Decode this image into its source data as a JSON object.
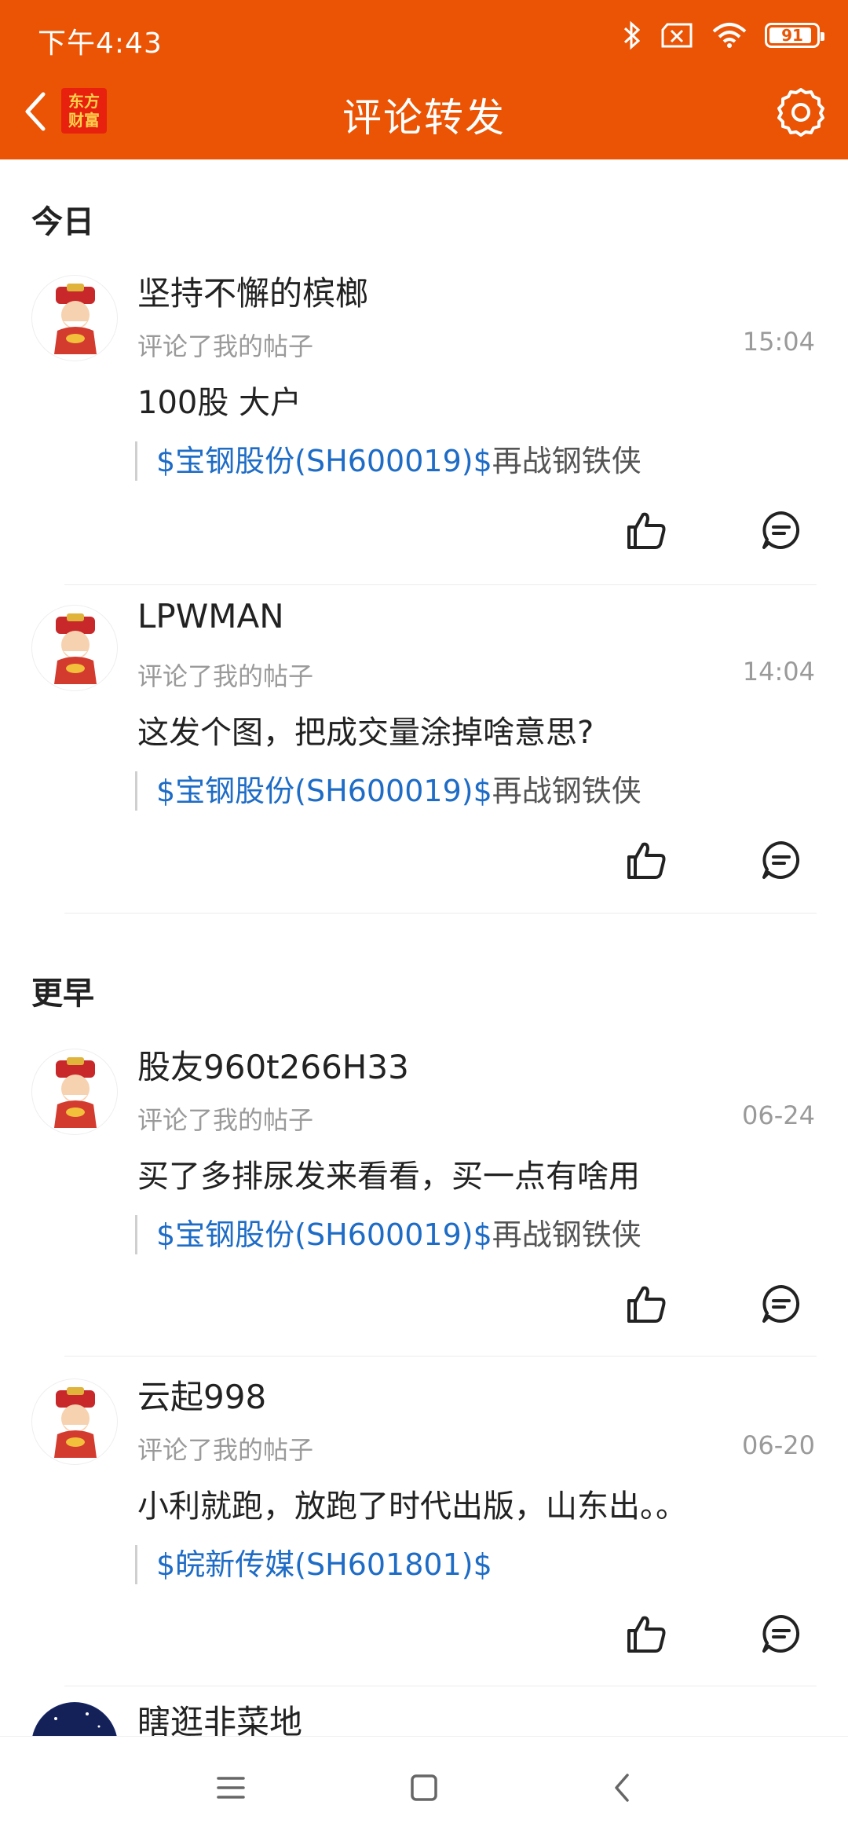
{
  "status": {
    "time": "下午4:43",
    "battery": "91",
    "battery_level_percent": 91
  },
  "header": {
    "title": "评论转发",
    "logo_line1": "东方",
    "logo_line2": "财富"
  },
  "colors": {
    "accent": "#EA5404",
    "link": "#1E6CC6",
    "muted": "#9a9a9a"
  },
  "sections": {
    "today": "今日",
    "earlier": "更早"
  },
  "items": [
    {
      "username": "坚持不懈的槟榔",
      "action": "评论了我的帖子",
      "time": "15:04",
      "comment": "100股 大户",
      "stock": "$宝钢股份(SH600019)$",
      "post_title": "再战钢铁侠"
    },
    {
      "username": "LPWMAN",
      "action": "评论了我的帖子",
      "time": "14:04",
      "comment": "这发个图，把成交量涂掉啥意思?",
      "stock": "$宝钢股份(SH600019)$",
      "post_title": "再战钢铁侠"
    },
    {
      "username": "股友960t266H33",
      "action": "评论了我的帖子",
      "time": "06-24",
      "comment": "买了多排尿发来看看，买一点有啥用",
      "stock": "$宝钢股份(SH600019)$",
      "post_title": "再战钢铁侠"
    },
    {
      "username": "云起998",
      "action": "评论了我的帖子",
      "time": "06-20",
      "comment": "小利就跑，放跑了时代出版，山东出。。",
      "stock": "$皖新传媒(SH601801)$",
      "post_title": ""
    },
    {
      "username": "瞎逛非菜地"
    }
  ]
}
